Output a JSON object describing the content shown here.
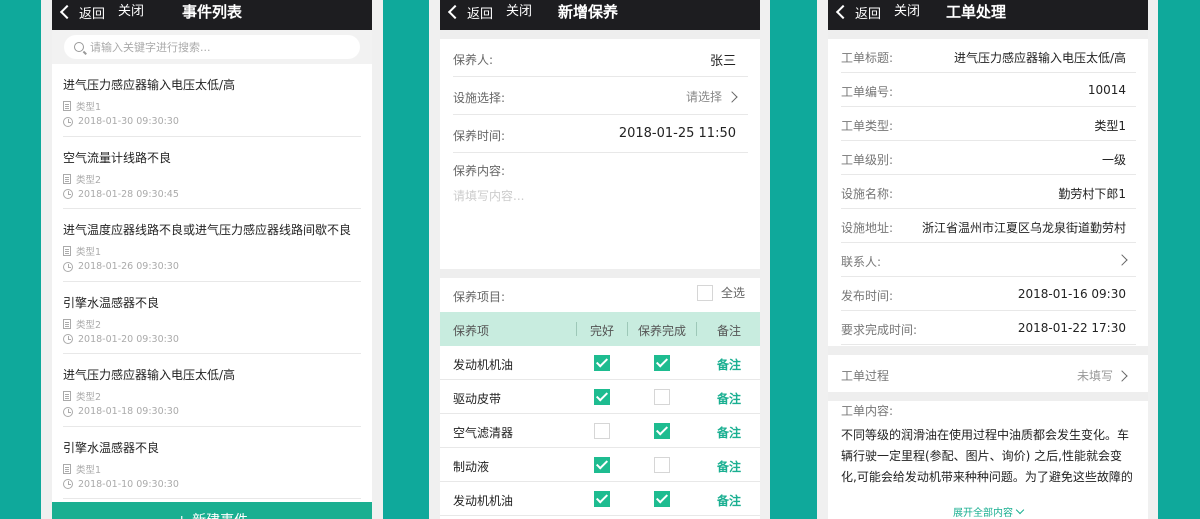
{
  "nav": {
    "back_label": "返回",
    "close_label": "关闭"
  },
  "event_list": {
    "title": "事件列表",
    "search_placeholder": "请输入关键字进行搜索...",
    "items": [
      {
        "title": "进气压力感应器输入电压太低/高",
        "type": "类型1",
        "time": "2018-01-30 09:30:30"
      },
      {
        "title": "空气流量计线路不良",
        "type": "类型2",
        "time": "2018-01-28 09:30:45"
      },
      {
        "title": "进气温度应器线路不良或进气压力感应器线路间歇不良",
        "type": "类型1",
        "time": "2018-01-26 09:30:30"
      },
      {
        "title": "引擎水温感器不良",
        "type": "类型2",
        "time": "2018-01-20 09:30:30"
      },
      {
        "title": "进气压力感应器输入电压太低/高",
        "type": "类型2",
        "time": "2018-01-18 09:30:30"
      },
      {
        "title": "引擎水温感器不良",
        "type": "类型1",
        "time": "2018-01-10 09:30:30"
      }
    ],
    "new_button": "+ 新建事件"
  },
  "maintenance": {
    "title": "新增保养",
    "person_label": "保养人:",
    "person_value": "张三",
    "facility_label": "设施选择:",
    "facility_placeholder": "请选择",
    "time_label": "保养时间:",
    "time_value": "2018-01-25 11:50",
    "content_label": "保养内容:",
    "content_placeholder": "请填写内容...",
    "items_label": "保养项目:",
    "select_all_label": "全选",
    "table_headers": [
      "保养项",
      "完好",
      "保养完成",
      "备注"
    ],
    "rows": [
      {
        "name": "发动机机油",
        "good": true,
        "done": true,
        "note": "备注"
      },
      {
        "name": "驱动皮带",
        "good": true,
        "done": false,
        "note": "备注"
      },
      {
        "name": "空气滤清器",
        "good": false,
        "done": true,
        "note": "备注"
      },
      {
        "name": "制动液",
        "good": true,
        "done": false,
        "note": "备注"
      },
      {
        "name": "发动机机油",
        "good": true,
        "done": true,
        "note": "备注"
      }
    ]
  },
  "work_order": {
    "title": "工单处理",
    "fields": [
      {
        "label": "工单标题:",
        "value": "进气压力感应器输入电压太低/高"
      },
      {
        "label": "工单编号:",
        "value": "10014"
      },
      {
        "label": "工单类型:",
        "value": "类型1"
      },
      {
        "label": "工单级别:",
        "value": "一级"
      },
      {
        "label": "设施名称:",
        "value": "勤劳村下郎1"
      },
      {
        "label": "设施地址:",
        "value": "浙江省温州市江夏区乌龙泉街道勤劳村"
      },
      {
        "label": "联系人:",
        "value": ""
      },
      {
        "label": "发布时间:",
        "value": "2018-01-16 09:30"
      },
      {
        "label": "要求完成时间:",
        "value": "2018-01-22 17:30"
      }
    ],
    "process_label": "工单过程",
    "process_value": "未填写",
    "content_label": "工单内容:",
    "content_body": "不同等级的润滑油在使用过程中油质都会发生变化。车辆行驶一定里程(参配、图片、询价) 之后,性能就会变化,可能会给发动机带来种种问题。为了避免这些故障的",
    "expand_label": "展开全部内容"
  },
  "colors": {
    "background": "#0fa99b",
    "accent": "#1aaf91",
    "navbar": "#1d1d20",
    "table_header": "#c8ecdf"
  },
  "icons": [
    "chevron-left-icon",
    "search-icon",
    "document-icon",
    "clock-icon",
    "chevron-right-icon",
    "checkbox-icon",
    "chevron-down-icon"
  ]
}
